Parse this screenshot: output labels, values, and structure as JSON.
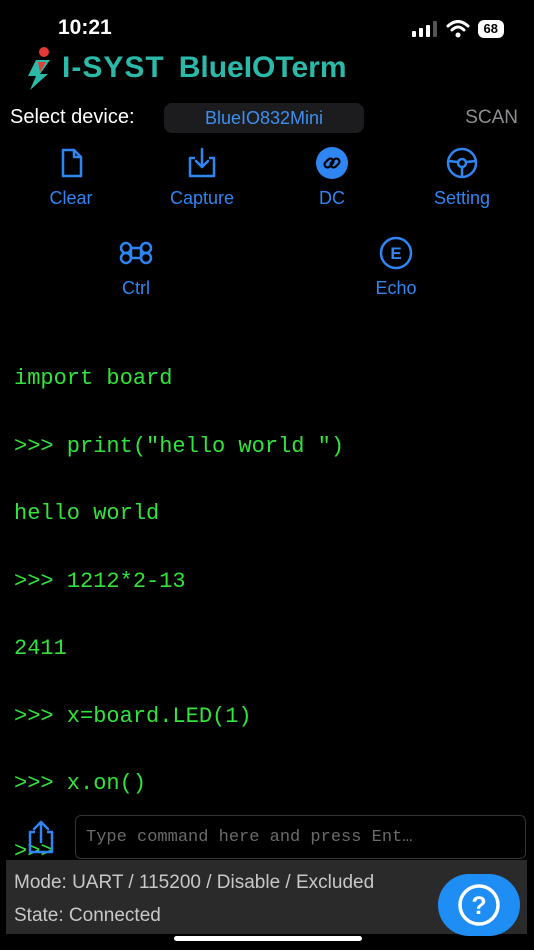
{
  "status": {
    "time": "10:21",
    "battery": "68"
  },
  "brand": {
    "company": "I-SYST",
    "app": "BlueIOTerm"
  },
  "device": {
    "label": "Select device:",
    "selected": "BlueIO832Mini",
    "scan": "SCAN"
  },
  "toolbar": {
    "clear": "Clear",
    "capture": "Capture",
    "dc": "DC",
    "setting": "Setting",
    "ctrl": "Ctrl",
    "echo": "Echo"
  },
  "terminal": {
    "lines": [
      "import board",
      ">>> print(\"hello world \")",
      "hello world",
      ">>> 1212*2-13",
      "2411",
      ">>> x=board.LED(1)",
      ">>> x.on()",
      ">>>"
    ]
  },
  "command": {
    "placeholder": "Type command here and press Ent…",
    "value": ""
  },
  "footer": {
    "mode": "Mode: UART / 115200 / Disable / Excluded",
    "state": "State: Connected"
  },
  "colors": {
    "accent": "#2f86f2",
    "terminal": "#32e33b",
    "brand": "#2bb9a9"
  }
}
